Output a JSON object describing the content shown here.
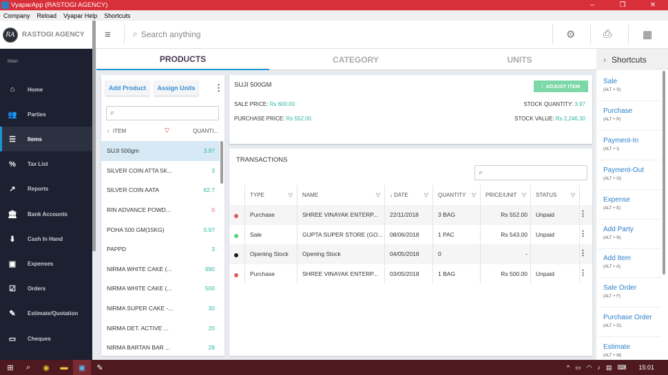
{
  "window": {
    "title": "VyaparApp (RASTOGI AGENCY)",
    "controls": [
      "–",
      "❐",
      "✕"
    ]
  },
  "menu": [
    "Company",
    "Reload",
    "Vyapar Help",
    "Shortcuts"
  ],
  "brand": {
    "logo_text": "RA",
    "name": "RASTOGI AGENCY"
  },
  "topbar": {
    "search_placeholder": "Search anything"
  },
  "sidebar": {
    "section": "Main",
    "items": [
      {
        "label": "Home",
        "icon": "⌂"
      },
      {
        "label": "Parties",
        "icon": "👥"
      },
      {
        "label": "Items",
        "icon": "☰",
        "active": true
      },
      {
        "label": "Tax List",
        "icon": "%"
      },
      {
        "label": "Reports",
        "icon": "↗"
      },
      {
        "label": "Bank Accounts",
        "icon": "🏛"
      },
      {
        "label": "Cash In Hand",
        "icon": "⬇"
      },
      {
        "label": "Expenses",
        "icon": "▣"
      },
      {
        "label": "Orders",
        "icon": "☑"
      },
      {
        "label": "Estimate/Quotation",
        "icon": "✎"
      },
      {
        "label": "Cheques",
        "icon": "▭"
      }
    ]
  },
  "tabs": [
    {
      "label": "PRODUCTS",
      "active": true
    },
    {
      "label": "CATEGORY"
    },
    {
      "label": "UNITS"
    }
  ],
  "products": {
    "add_label": "Add Product",
    "assign_label": "Assign Units",
    "col_item": "ITEM",
    "col_qty": "QUANTI...",
    "rows": [
      {
        "name": "SUJI 500gm",
        "qty": "3.97",
        "selected": true
      },
      {
        "name": "SILVER COIN ATTA 5K...",
        "qty": "3"
      },
      {
        "name": "SILVER COIN AATA",
        "qty": "62.7"
      },
      {
        "name": "RIN ADVANCE POWD...",
        "qty": "0",
        "zero": true
      },
      {
        "name": "POHA 500 GM(15KG)",
        "qty": "0.97"
      },
      {
        "name": "PAPPD",
        "qty": "3"
      },
      {
        "name": "NIRMA WHITE CAKE (...",
        "qty": "690"
      },
      {
        "name": "NIRMA WHITE CAKE (...",
        "qty": "500"
      },
      {
        "name": "NIRMA SUPER CAKE -...",
        "qty": "30"
      },
      {
        "name": "NIRMA DET. ACTIVE ...",
        "qty": "20"
      },
      {
        "name": "NIRMA BARTAN BAR ...",
        "qty": "28"
      }
    ]
  },
  "detail": {
    "title": "SUJI 500GM",
    "adjust_label": "ADJUST ITEM",
    "sale_price_label": "SALE PRICE:",
    "sale_price": "Rs 600.00",
    "purchase_price_label": "PURCHASE PRICE:",
    "purchase_price": "Rs 552.00",
    "stock_qty_label": "STOCK QUANTITY:",
    "stock_qty": "3.97",
    "stock_value_label": "STOCK VALUE:",
    "stock_value": "Rs 2,246.30"
  },
  "transactions": {
    "title": "TRANSACTIONS",
    "columns": [
      "TYPE",
      "NAME",
      "DATE",
      "QUANTITY",
      "PRICE/UNIT",
      "STATUS"
    ],
    "rows": [
      {
        "type": "Purchase",
        "name": "SHREE VINAYAK ENTERP...",
        "date": "22/11/2018",
        "qty": "3 BAG",
        "price": "Rs 552.00",
        "status": "Unpaid",
        "color": "#e05a5a"
      },
      {
        "type": "Sale",
        "name": "GUPTA SUPER STORE (GO...",
        "date": "08/06/2018",
        "qty": "1 PAC",
        "price": "Rs 543.00",
        "status": "Unpaid",
        "color": "#4cd480"
      },
      {
        "type": "Opening Stock",
        "name": "Opening Stock",
        "date": "04/05/2018",
        "qty": "0",
        "price": "-",
        "status": "",
        "color": "#1a1a1a"
      },
      {
        "type": "Purchase",
        "name": "SHREE VINAYAK ENTERP...",
        "date": "03/05/2018",
        "qty": "1 BAG",
        "price": "Rs 500.00",
        "status": "Unpaid",
        "color": "#e05a5a"
      }
    ]
  },
  "shortcuts": {
    "title": "Shortcuts",
    "items": [
      {
        "label": "Sale",
        "key": "(ALT + S)"
      },
      {
        "label": "Purchase",
        "key": "(ALT + P)"
      },
      {
        "label": "Payment-In",
        "key": "(ALT + I)"
      },
      {
        "label": "Payment-Out",
        "key": "(ALT + O)"
      },
      {
        "label": "Expense",
        "key": "(ALT + E)"
      },
      {
        "label": "Add Party",
        "key": "(ALT + N)"
      },
      {
        "label": "Add Item",
        "key": "(ALT + A)"
      },
      {
        "label": "Sale Order",
        "key": "(ALT + F)"
      },
      {
        "label": "Purchase Order",
        "key": "(ALT + G)"
      },
      {
        "label": "Estimate",
        "key": "(ALT + M)"
      }
    ]
  },
  "taskbar": {
    "time": "15:01"
  }
}
